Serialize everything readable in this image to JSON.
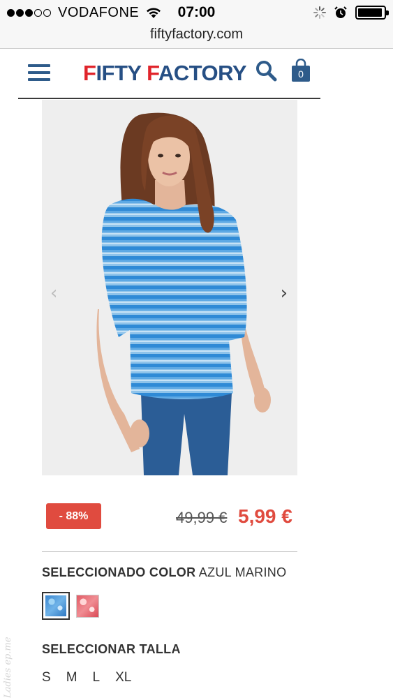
{
  "status_bar": {
    "carrier": "VODAFONE",
    "time": "07:00",
    "signal_bars_filled": 3,
    "signal_bars_total": 5,
    "battery_level": 0.95
  },
  "browser": {
    "url": "fiftyfactory.com"
  },
  "header": {
    "logo_part1_letter": "F",
    "logo_part1_rest": "IFTY ",
    "logo_part2_letter": "F",
    "logo_part2_rest": "ACTORY",
    "cart_count": "0",
    "colors": {
      "red": "#e0242b",
      "blue": "#264f84"
    }
  },
  "product": {
    "prev_arrow": "‹",
    "next_arrow": "›",
    "discount": "- 88%",
    "old_price": "49,99 €",
    "new_price": "5,99 €",
    "color_label_bold": "SELECCIONADO COLOR",
    "color_value": "AZUL MARINO",
    "swatches": [
      "blue-swatch",
      "pink-swatch"
    ],
    "size_title": "SELECCIONAR TALLA",
    "sizes": [
      "S",
      "M",
      "L",
      "XL"
    ],
    "accent_color": "#e04b3f"
  },
  "watermark": "Ladies ep.me"
}
